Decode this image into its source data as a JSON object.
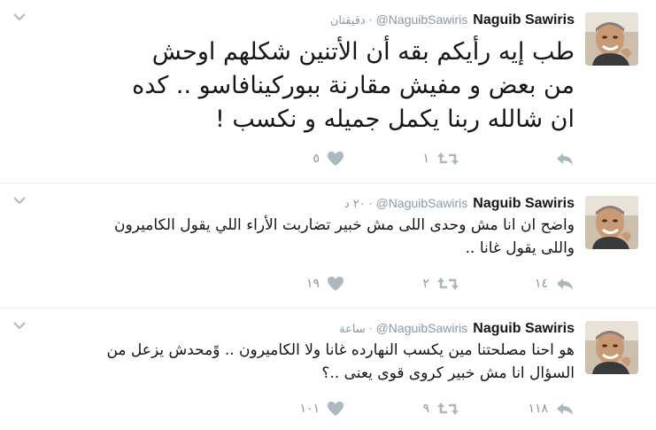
{
  "tweets": [
    {
      "name": "Naguib Sawiris",
      "handle": "@NaguibSawiris",
      "time": "دقيقتان",
      "lines": [
        "طب إيه رأيكم بقه أن الأتنين شكلهم اوحش",
        "من بعض و مفيش مقارنة ببوركينافاسو .. كده",
        "ان شالله ربنا يكمل جميله و نكسب !"
      ],
      "replies": "",
      "retweets": "١",
      "likes": "٥"
    },
    {
      "name": "Naguib Sawiris",
      "handle": "@NaguibSawiris",
      "time": "٢٠ د",
      "lines": [
        "واضح ان انا مش وحدى اللى مش خبير تضاربت الأراء اللي يقول الكاميرون",
        "واللى يقول غانا .."
      ],
      "replies": "١٤",
      "retweets": "٢",
      "likes": "١٩"
    },
    {
      "name": "Naguib Sawiris",
      "handle": "@NaguibSawiris",
      "time": "ساعة",
      "lines": [
        "هو احنا مصلحتنا مين يكسب النهارده غانا ولا الكاميرون .. وًمحدش يزعل من",
        "السؤال انا مش خبير كروى قوى يعنى ..؟"
      ],
      "replies": "١١٨",
      "retweets": "٩",
      "likes": "١٠١"
    }
  ],
  "colors": {
    "text": "#14171a",
    "muted": "#8899a6",
    "icon": "#aab8c2",
    "border": "#e6ecf0"
  },
  "icons": {
    "reply": "reply-icon",
    "retweet": "retweet-icon",
    "like": "heart-icon",
    "more": "chevron-down-icon"
  }
}
